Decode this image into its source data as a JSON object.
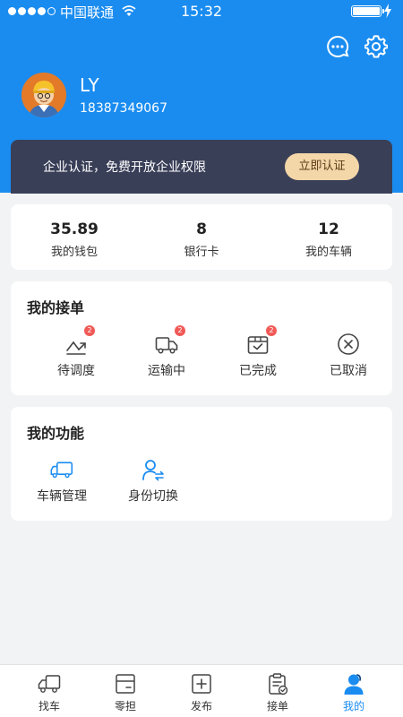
{
  "status_bar": {
    "carrier": "中国联通",
    "time": "15:32"
  },
  "user": {
    "name": "LY",
    "phone": "18387349067"
  },
  "cert": {
    "text": "企业认证，免费开放企业权限",
    "button": "立即认证"
  },
  "stats": [
    {
      "value": "35.89",
      "label": "我的钱包"
    },
    {
      "value": "8",
      "label": "银行卡"
    },
    {
      "value": "12",
      "label": "我的车辆"
    }
  ],
  "orders": {
    "title": "我的接单",
    "items": [
      {
        "label": "待调度",
        "icon": "dispatch-icon",
        "badge": "2"
      },
      {
        "label": "运输中",
        "icon": "truck-icon",
        "badge": "2"
      },
      {
        "label": "已完成",
        "icon": "box-check-icon",
        "badge": "2"
      },
      {
        "label": "已取消",
        "icon": "cancel-circle-icon"
      }
    ]
  },
  "functions": {
    "title": "我的功能",
    "items": [
      {
        "label": "车辆管理",
        "icon": "truck-icon"
      },
      {
        "label": "身份切换",
        "icon": "user-switch-icon"
      }
    ]
  },
  "tabs": [
    {
      "label": "找车",
      "icon": "truck-icon"
    },
    {
      "label": "零担",
      "icon": "package-icon"
    },
    {
      "label": "发布",
      "icon": "plus-square-icon"
    },
    {
      "label": "接单",
      "icon": "clipboard-icon"
    },
    {
      "label": "我的",
      "icon": "user-icon",
      "active": true
    }
  ],
  "colors": {
    "primary": "#1a8cf0",
    "banner": "#3a3f58",
    "gold": "#f3d7a9",
    "badge": "#f05a57"
  }
}
